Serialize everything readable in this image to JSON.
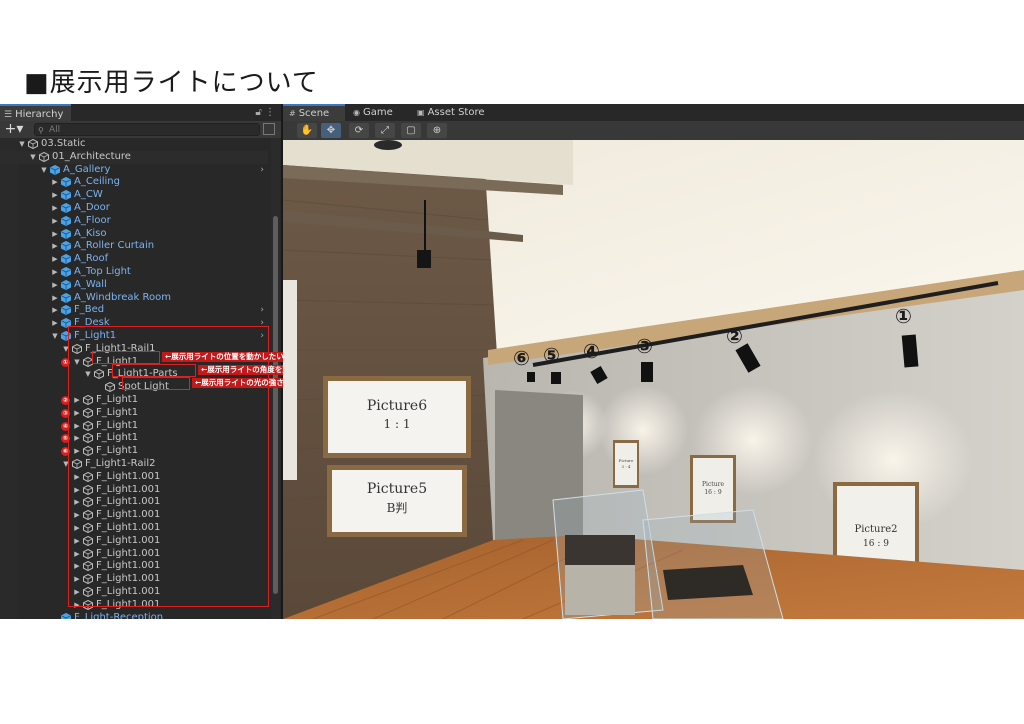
{
  "page": {
    "title": "■展示用ライトについて"
  },
  "hierarchy": {
    "tab_label": "Hierarchy",
    "search_placeholder": "All",
    "plus_label": "+▾",
    "rows": [
      {
        "label": "03.Static",
        "depth": 1,
        "color": "gray",
        "arrow": "▼",
        "cube": "gray"
      },
      {
        "label": "01_Architecture",
        "depth": 2,
        "color": "gray",
        "arrow": "▼",
        "cube": "gray"
      },
      {
        "label": "A_Gallery",
        "depth": 3,
        "color": "blue",
        "arrow": "▼",
        "cube": "blue",
        "chev": true
      },
      {
        "label": "A_Ceiling",
        "depth": 4,
        "color": "blue",
        "arrow": "▶",
        "cube": "blue"
      },
      {
        "label": "A_CW",
        "depth": 4,
        "color": "blue",
        "arrow": "▶",
        "cube": "blue"
      },
      {
        "label": "A_Door",
        "depth": 4,
        "color": "blue",
        "arrow": "▶",
        "cube": "blue"
      },
      {
        "label": "A_Floor",
        "depth": 4,
        "color": "blue",
        "arrow": "▶",
        "cube": "blue"
      },
      {
        "label": "A_Kiso",
        "depth": 4,
        "color": "blue",
        "arrow": "▶",
        "cube": "blue"
      },
      {
        "label": "A_Roller Curtain",
        "depth": 4,
        "color": "blue",
        "arrow": "▶",
        "cube": "blue"
      },
      {
        "label": "A_Roof",
        "depth": 4,
        "color": "blue",
        "arrow": "▶",
        "cube": "blue"
      },
      {
        "label": "A_Top Light",
        "depth": 4,
        "color": "blue",
        "arrow": "▶",
        "cube": "blue"
      },
      {
        "label": "A_Wall",
        "depth": 4,
        "color": "blue",
        "arrow": "▶",
        "cube": "blue"
      },
      {
        "label": "A_Windbreak Room",
        "depth": 4,
        "color": "blue",
        "arrow": "▶",
        "cube": "blue"
      },
      {
        "label": "F_Bed",
        "depth": 4,
        "color": "blue",
        "arrow": "▶",
        "cube": "blue",
        "chev": true
      },
      {
        "label": "F_Desk",
        "depth": 4,
        "color": "blue",
        "arrow": "▶",
        "cube": "blue",
        "chev": true
      },
      {
        "label": "F_Light1",
        "depth": 4,
        "color": "blue",
        "arrow": "▼",
        "cube": "blue",
        "chev": true
      },
      {
        "label": "F_Light1-Rail1",
        "depth": 5,
        "color": "gray",
        "arrow": "▼",
        "cube": "gray"
      },
      {
        "label": "F_Light1",
        "depth": 6,
        "color": "gray",
        "arrow": "▼",
        "cube": "gray",
        "badge": "①"
      },
      {
        "label": "F_Light1-Parts",
        "depth": 7,
        "color": "gray",
        "arrow": "▼",
        "cube": "gray"
      },
      {
        "label": "Spot Light",
        "depth": 8,
        "color": "gray",
        "arrow": "",
        "cube": "gray"
      },
      {
        "label": "F_Light1",
        "depth": 6,
        "color": "gray",
        "arrow": "▶",
        "cube": "gray",
        "badge": "②"
      },
      {
        "label": "F_Light1",
        "depth": 6,
        "color": "gray",
        "arrow": "▶",
        "cube": "gray",
        "badge": "③"
      },
      {
        "label": "F_Light1",
        "depth": 6,
        "color": "gray",
        "arrow": "▶",
        "cube": "gray",
        "badge": "④"
      },
      {
        "label": "F_Light1",
        "depth": 6,
        "color": "gray",
        "arrow": "▶",
        "cube": "gray",
        "badge": "⑤"
      },
      {
        "label": "F_Light1",
        "depth": 6,
        "color": "gray",
        "arrow": "▶",
        "cube": "gray",
        "badge": "⑥"
      },
      {
        "label": "F_Light1-Rail2",
        "depth": 5,
        "color": "gray",
        "arrow": "▼",
        "cube": "gray"
      },
      {
        "label": "F_Light1.001",
        "depth": 6,
        "color": "gray",
        "arrow": "▶",
        "cube": "gray"
      },
      {
        "label": "F_Light1.001",
        "depth": 6,
        "color": "gray",
        "arrow": "▶",
        "cube": "gray"
      },
      {
        "label": "F_Light1.001",
        "depth": 6,
        "color": "gray",
        "arrow": "▶",
        "cube": "gray"
      },
      {
        "label": "F_Light1.001",
        "depth": 6,
        "color": "gray",
        "arrow": "▶",
        "cube": "gray"
      },
      {
        "label": "F_Light1.001",
        "depth": 6,
        "color": "gray",
        "arrow": "▶",
        "cube": "gray"
      },
      {
        "label": "F_Light1.001",
        "depth": 6,
        "color": "gray",
        "arrow": "▶",
        "cube": "gray"
      },
      {
        "label": "F_Light1.001",
        "depth": 6,
        "color": "gray",
        "arrow": "▶",
        "cube": "gray"
      },
      {
        "label": "F_Light1.001",
        "depth": 6,
        "color": "gray",
        "arrow": "▶",
        "cube": "gray"
      },
      {
        "label": "F_Light1.001",
        "depth": 6,
        "color": "gray",
        "arrow": "▶",
        "cube": "gray"
      },
      {
        "label": "F_Light1.001",
        "depth": 6,
        "color": "gray",
        "arrow": "▶",
        "cube": "gray"
      },
      {
        "label": "F_Light1.001",
        "depth": 6,
        "color": "gray",
        "arrow": "▶",
        "cube": "gray"
      },
      {
        "label": "F_Light-Reception",
        "depth": 4,
        "color": "blue",
        "arrow": "",
        "cube": "blue"
      }
    ]
  },
  "annotations": {
    "position": "←展示用ライトの位置を動かしたい場合はこのオブジェクトを移動",
    "angle": "←展示用ライトの角度を変えたい場合はこのオブジェクトの角度を調整",
    "light": "←展示用ライトの光の強さ・色などを変えたい場合はこのオブジェクトを調整"
  },
  "scene": {
    "tabs": [
      {
        "label": "Scene",
        "icon": "grid-icon",
        "active": true
      },
      {
        "label": "Game",
        "icon": "gamepad-icon",
        "active": false
      },
      {
        "label": "Asset Store",
        "icon": "bag-icon",
        "active": false
      }
    ],
    "tools": [
      {
        "name": "hand-tool",
        "glyph": "✋",
        "active": false
      },
      {
        "name": "move-tool",
        "glyph": "✥",
        "active": true
      },
      {
        "name": "rotate-tool",
        "glyph": "⟳",
        "active": false
      },
      {
        "name": "scale-tool",
        "glyph": "⤢",
        "active": false
      },
      {
        "name": "rect-tool",
        "glyph": "▢",
        "active": false
      },
      {
        "name": "transform-tool",
        "glyph": "⊕",
        "active": false
      }
    ],
    "pictures": {
      "p6_line1": "Picture6",
      "p6_line2": "1 : 1",
      "p5_line1": "Picture5",
      "p5_line2": "B判",
      "p2_line1": "Picture2",
      "p2_line2": "16 : 9",
      "p_small1": "Picture",
      "p_small1b": "3 : 4",
      "p_small2": "Picture",
      "p_small2b": "16 : 9"
    },
    "markers": [
      "⑥",
      "⑤",
      "④",
      "③",
      "②",
      "①"
    ]
  },
  "colors": {
    "accent": "#3a79bb",
    "annotation_red": "#e02020",
    "tree_blue": "#7db3f0"
  }
}
